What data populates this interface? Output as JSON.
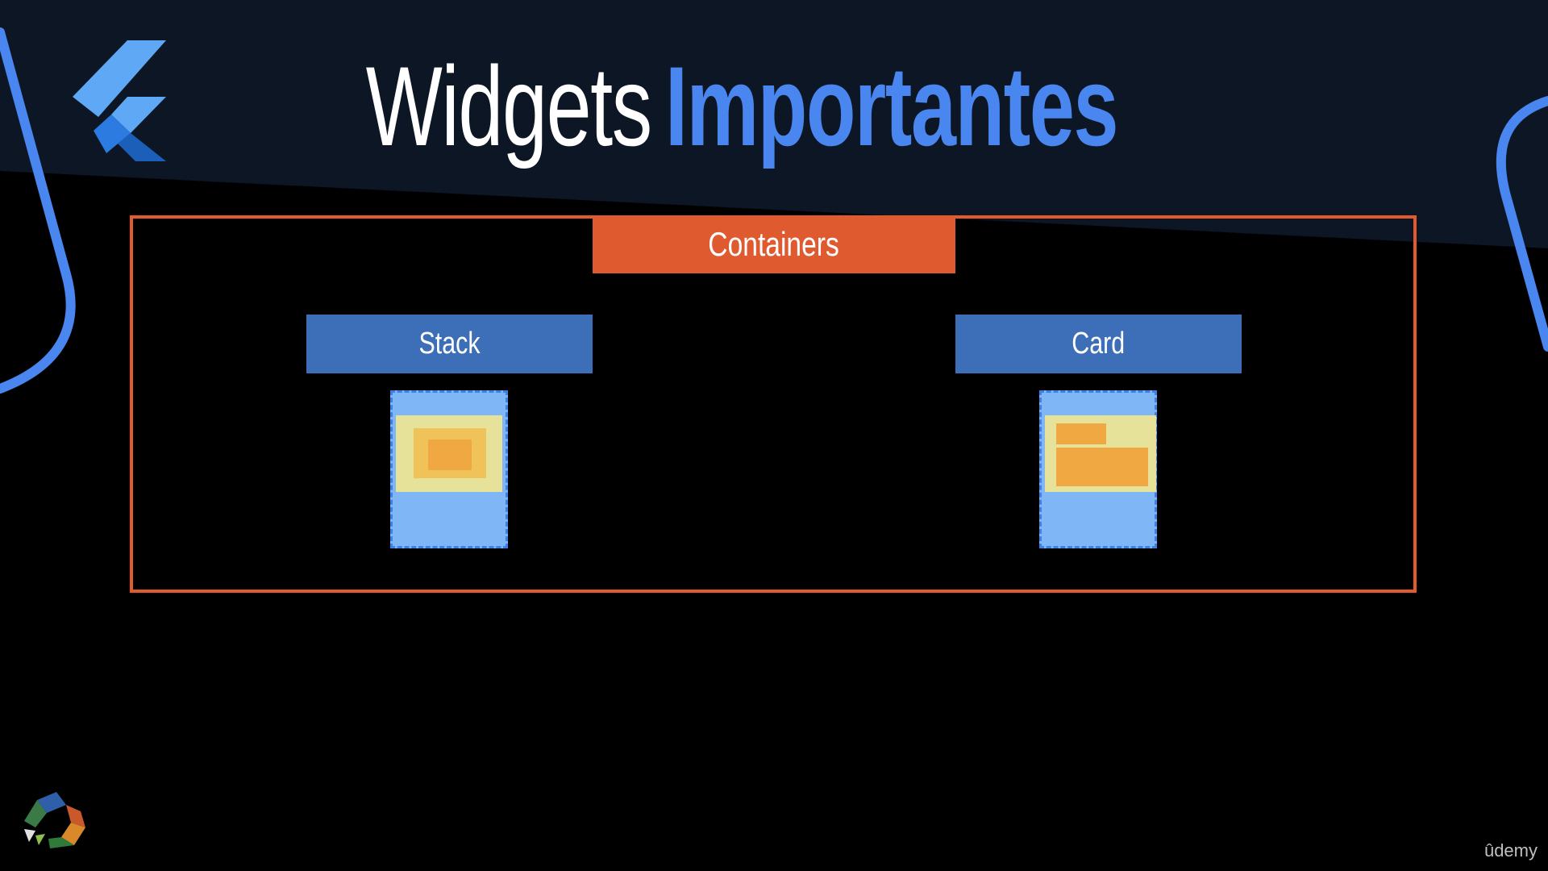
{
  "slide": {
    "title_part1": "Widgets",
    "title_part2": "Importantes",
    "group_label": "Containers",
    "widgets": [
      {
        "label": "Stack"
      },
      {
        "label": "Card"
      }
    ],
    "watermark": "ûdemy"
  },
  "colors": {
    "title_white": "#ffffff",
    "title_accent": "#4a86f0",
    "group_orange": "#e05a30",
    "widget_blue": "#3c6fb8",
    "phone_blue": "#7fb6f5",
    "inner_yellow": "#e6e29a",
    "inner_orange": "#f0a843",
    "inner_orange_light": "#f0c25a",
    "banner_navy": "#0d1624"
  },
  "icons": [
    "flutter-logo-icon",
    "course-logo-icon"
  ]
}
